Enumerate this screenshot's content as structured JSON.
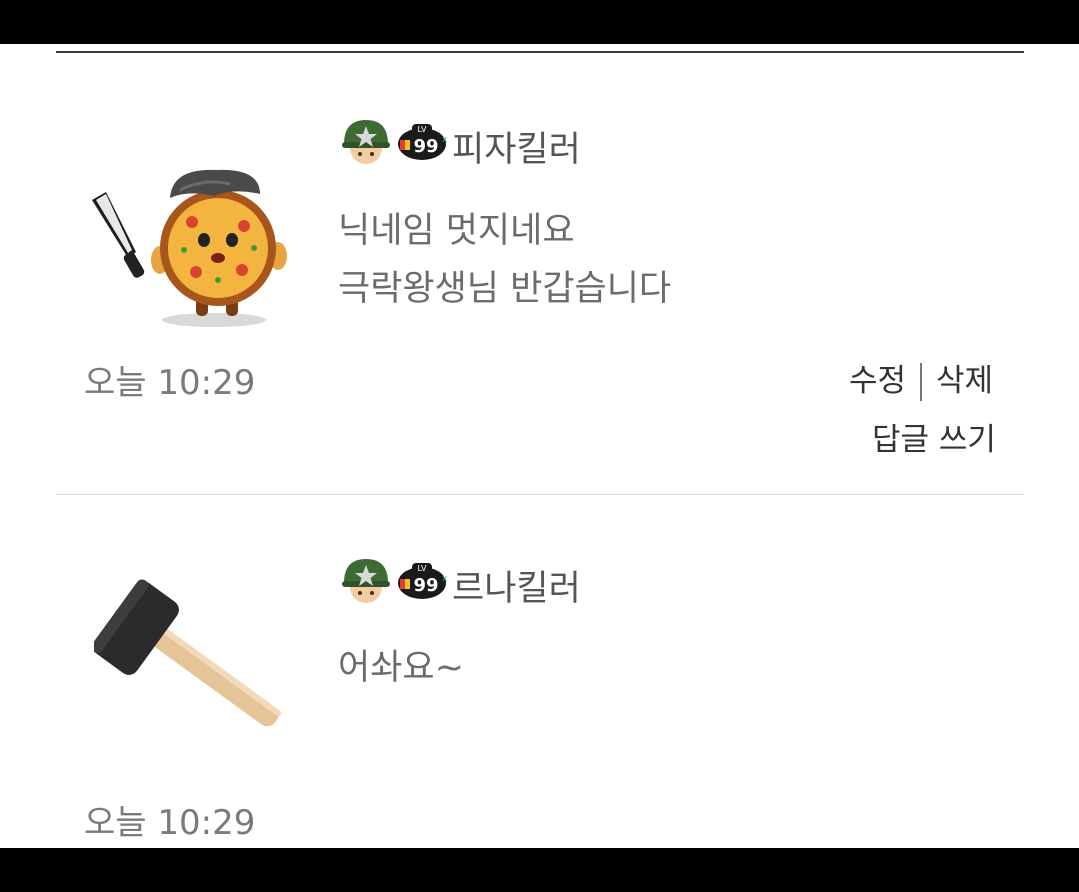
{
  "comments": [
    {
      "avatar_icon": "pizza-character-with-knife-icon",
      "badge_icons": [
        "soldier-helmet-icon",
        "level-99-badge-icon"
      ],
      "username": "피자킬러",
      "lines": [
        "닉네임 멋지네요",
        "극락왕생님 반갑습니다"
      ],
      "time": "오늘 10:29",
      "actions": {
        "edit": "수정",
        "delete": "삭제",
        "reply": "답글 쓰기"
      }
    },
    {
      "avatar_icon": "mallet-hammer-icon",
      "badge_icons": [
        "soldier-helmet-icon",
        "level-99-badge-icon"
      ],
      "username": "르나킬러",
      "lines": [
        "어솨요~"
      ],
      "time": "오늘 10:29"
    }
  ],
  "colors": {
    "divider": "#d6d6d6",
    "text": "#6b6b6b",
    "action": "#333333",
    "bars": "#000000"
  }
}
